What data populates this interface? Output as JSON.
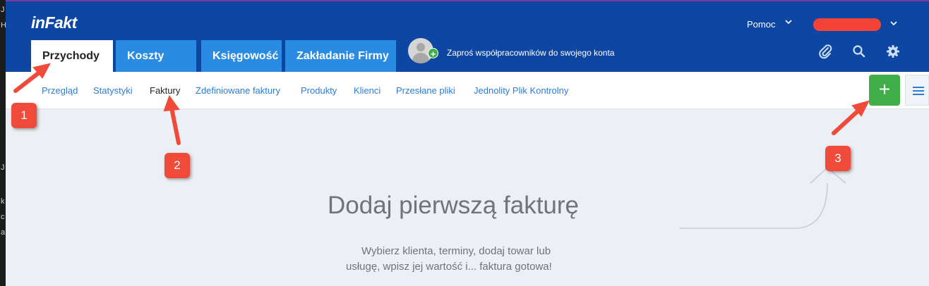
{
  "app": {
    "logo": "inFakt"
  },
  "main_tabs": [
    {
      "label": "Przychody",
      "active": true
    },
    {
      "label": "Koszty",
      "active": false
    },
    {
      "label": "Księgowość",
      "active": false
    },
    {
      "label": "Zakładanie Firmy",
      "active": false
    }
  ],
  "invite": {
    "text": "Zaproś współpracowników do swojego konta"
  },
  "header_right": {
    "help_label": "Pomoc",
    "user_name_redacted": true
  },
  "header_icons": [
    "paperclip-icon",
    "search-icon",
    "gear-icon"
  ],
  "subnav": [
    {
      "label": "Przegląd",
      "active": false
    },
    {
      "label": "Statystyki",
      "active": false
    },
    {
      "label": "Faktury",
      "active": true
    },
    {
      "label": "Zdefiniowane faktury",
      "active": false
    },
    {
      "label": "Produkty",
      "active": false
    },
    {
      "label": "Klienci",
      "active": false
    },
    {
      "label": "Przesłane pliki",
      "active": false
    },
    {
      "label": "Jednolity Plik Kontrolny",
      "active": false
    }
  ],
  "add_button": {
    "label": "+"
  },
  "empty_state": {
    "title": "Dodaj pierwszą fakturę",
    "description_line1": "Wybierz klienta, terminy, dodaj towar lub",
    "description_line2": "usługę, wpisz jej wartość i... faktura gotowa!"
  },
  "annotations": [
    "1",
    "2",
    "3"
  ],
  "left_edge_chars": [
    "J",
    "H",
    "",
    "",
    "",
    "",
    "",
    "",
    "",
    "",
    "",
    "",
    "",
    "",
    "",
    "",
    "",
    "",
    "",
    "J",
    "",
    "",
    "k",
    "c",
    "a"
  ],
  "colors": {
    "header": "#0e46a3",
    "tab_inactive": "#2a8be3",
    "link": "#2a7dd8",
    "add_button": "#3fae49",
    "annotation_badge": "#f04a3b",
    "redaction": "#f44336"
  }
}
